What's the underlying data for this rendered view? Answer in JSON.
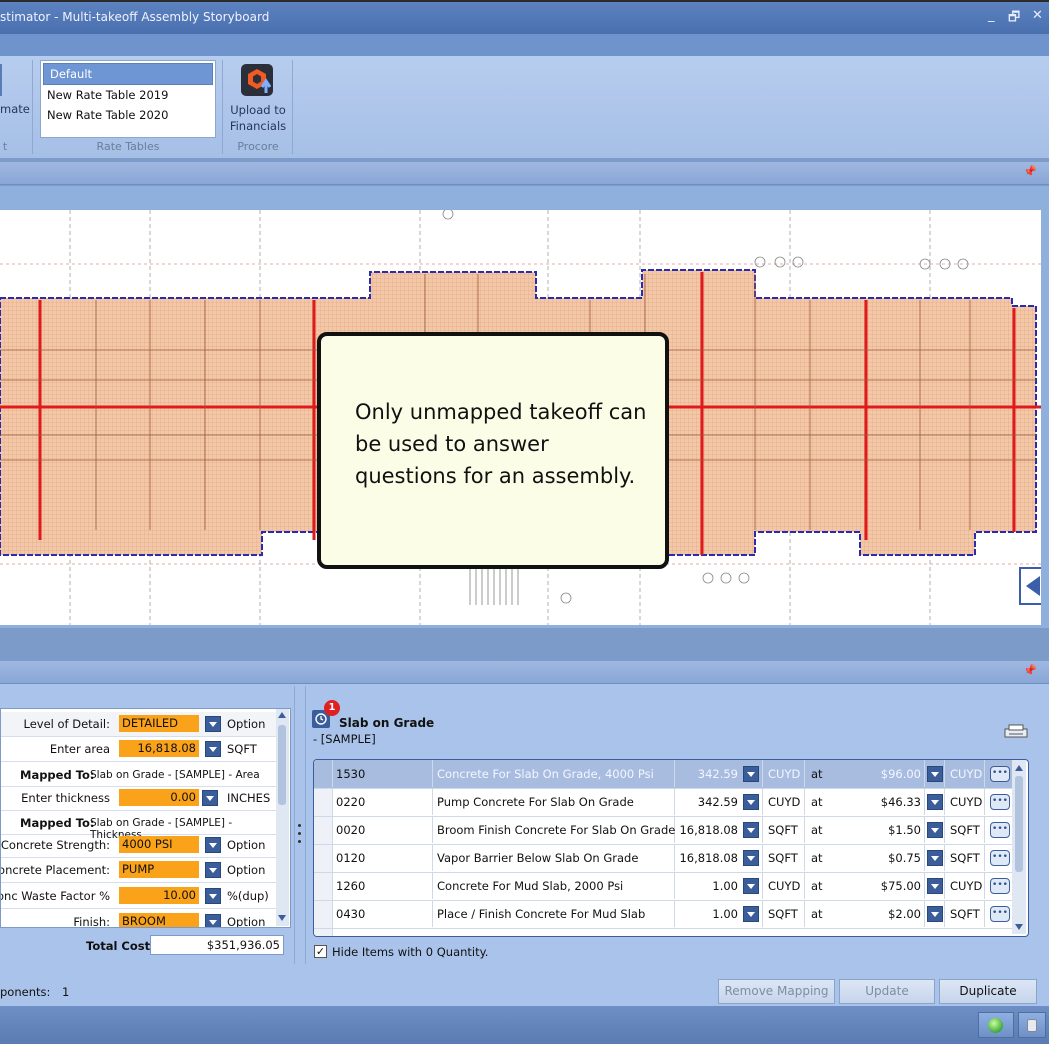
{
  "window": {
    "title": "stimator - Multi-takeoff Assembly Storyboard"
  },
  "ribbon": {
    "partial_label": "mate",
    "partial_group": "t",
    "rate_tables": [
      "Default",
      "New Rate Table 2019",
      "New Rate Table 2020"
    ],
    "rate_tables_group": "Rate Tables",
    "upload_label_1": "Upload to",
    "upload_label_2": "Financials",
    "procore_group": "Procore"
  },
  "drawing": {
    "tooltip": "Only unmapped takeoff can be used to answer questions for an assembly."
  },
  "questions": [
    {
      "kind": "q",
      "label": "Level of Detail:",
      "value": "DETAILED",
      "unit": "Option",
      "align": "l"
    },
    {
      "kind": "q",
      "label": "Enter area",
      "value": "16,818.08",
      "unit": "SQFT",
      "align": "r"
    },
    {
      "kind": "m",
      "label": "Mapped To:",
      "text": "Slab on Grade - [SAMPLE] - Area"
    },
    {
      "kind": "q",
      "label": "Enter thickness",
      "value": "0.00",
      "unit": "INCHES",
      "align": "r"
    },
    {
      "kind": "m",
      "label": "Mapped To:",
      "text": "Slab on Grade - [SAMPLE] - Thickness"
    },
    {
      "kind": "q",
      "label": "Concrete Strength:",
      "value": "4000 PSI",
      "unit": "Option",
      "align": "l"
    },
    {
      "kind": "q",
      "label": "Concrete Placement:",
      "value": "PUMP",
      "unit": "Option",
      "align": "l"
    },
    {
      "kind": "q",
      "label": "Conc Waste Factor %",
      "value": "10.00",
      "unit": "%(dup)",
      "align": "r"
    },
    {
      "kind": "q",
      "label": "Finish:",
      "value": "BROOM",
      "unit": "Option",
      "align": "l"
    }
  ],
  "total": {
    "label": "Total Cost:",
    "value": "$351,936.05"
  },
  "components": {
    "label": "ponents:",
    "value": "1"
  },
  "assembly": {
    "badge": "1",
    "name": "Slab on Grade",
    "sub": "- [SAMPLE]"
  },
  "items": [
    {
      "code": "1530",
      "desc": "Concrete For Slab On Grade, 4000 Psi",
      "qty": "342.59",
      "unit": "CUYD",
      "at": "at",
      "price": "$96.00",
      "punit": "CUYD"
    },
    {
      "code": "0220",
      "desc": "Pump Concrete For Slab On Grade",
      "qty": "342.59",
      "unit": "CUYD",
      "at": "at",
      "price": "$46.33",
      "punit": "CUYD"
    },
    {
      "code": "0020",
      "desc": "Broom Finish Concrete For Slab On Grade",
      "qty": "16,818.08",
      "unit": "SQFT",
      "at": "at",
      "price": "$1.50",
      "punit": "SQFT"
    },
    {
      "code": "0120",
      "desc": "Vapor Barrier Below Slab On Grade",
      "qty": "16,818.08",
      "unit": "SQFT",
      "at": "at",
      "price": "$0.75",
      "punit": "SQFT"
    },
    {
      "code": "1260",
      "desc": "Concrete For Mud Slab, 2000 Psi",
      "qty": "1.00",
      "unit": "CUYD",
      "at": "at",
      "price": "$75.00",
      "punit": "CUYD"
    },
    {
      "code": "0430",
      "desc": "Place / Finish Concrete For Mud Slab",
      "qty": "1.00",
      "unit": "SQFT",
      "at": "at",
      "price": "$2.00",
      "punit": "SQFT"
    }
  ],
  "hide_zero": {
    "label": "Hide Items with 0 Quantity.",
    "checked": true
  },
  "buttons": {
    "remove": "Remove Mapping",
    "update": "Update",
    "duplicate": "Duplicate"
  },
  "colors": {
    "accent": "#f9a21a",
    "markup": "#e01a1a",
    "boundary": "#3a3ab0"
  }
}
